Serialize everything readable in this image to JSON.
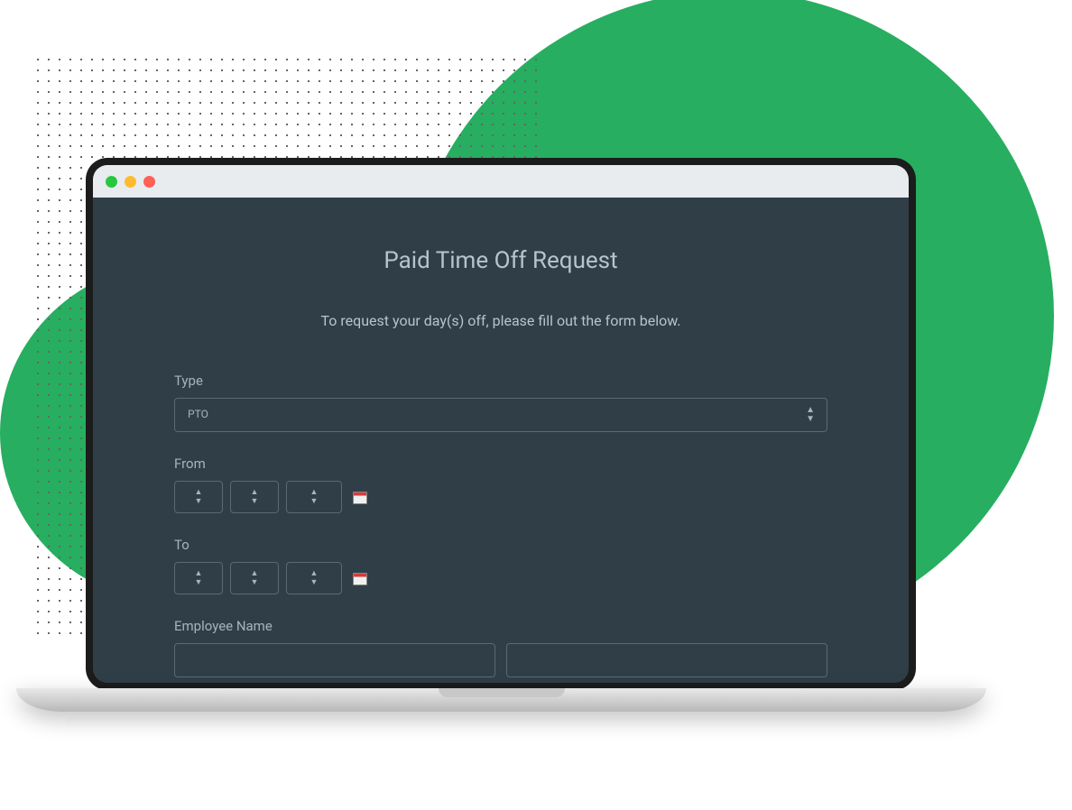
{
  "form": {
    "title": "Paid Time Off Request",
    "subtitle": "To request your day(s) off, please fill out the form below.",
    "fields": {
      "type": {
        "label": "Type",
        "value": "PTO"
      },
      "from": {
        "label": "From"
      },
      "to": {
        "label": "To"
      },
      "employee_name": {
        "label": "Employee Name"
      }
    }
  }
}
